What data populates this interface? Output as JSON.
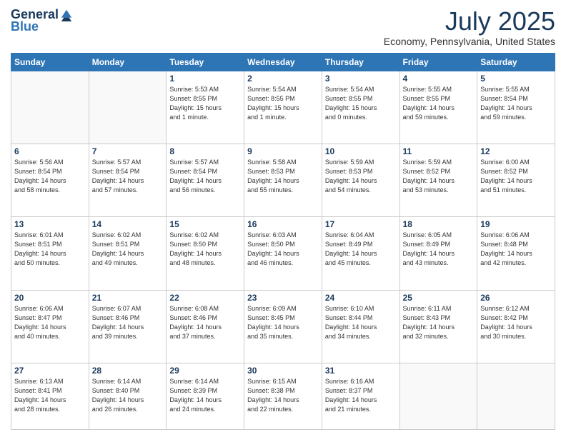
{
  "logo": {
    "general": "General",
    "blue": "Blue"
  },
  "title": "July 2025",
  "location": "Economy, Pennsylvania, United States",
  "days_of_week": [
    "Sunday",
    "Monday",
    "Tuesday",
    "Wednesday",
    "Thursday",
    "Friday",
    "Saturday"
  ],
  "weeks": [
    [
      {
        "day": "",
        "detail": ""
      },
      {
        "day": "",
        "detail": ""
      },
      {
        "day": "1",
        "detail": "Sunrise: 5:53 AM\nSunset: 8:55 PM\nDaylight: 15 hours\nand 1 minute."
      },
      {
        "day": "2",
        "detail": "Sunrise: 5:54 AM\nSunset: 8:55 PM\nDaylight: 15 hours\nand 1 minute."
      },
      {
        "day": "3",
        "detail": "Sunrise: 5:54 AM\nSunset: 8:55 PM\nDaylight: 15 hours\nand 0 minutes."
      },
      {
        "day": "4",
        "detail": "Sunrise: 5:55 AM\nSunset: 8:55 PM\nDaylight: 14 hours\nand 59 minutes."
      },
      {
        "day": "5",
        "detail": "Sunrise: 5:55 AM\nSunset: 8:54 PM\nDaylight: 14 hours\nand 59 minutes."
      }
    ],
    [
      {
        "day": "6",
        "detail": "Sunrise: 5:56 AM\nSunset: 8:54 PM\nDaylight: 14 hours\nand 58 minutes."
      },
      {
        "day": "7",
        "detail": "Sunrise: 5:57 AM\nSunset: 8:54 PM\nDaylight: 14 hours\nand 57 minutes."
      },
      {
        "day": "8",
        "detail": "Sunrise: 5:57 AM\nSunset: 8:54 PM\nDaylight: 14 hours\nand 56 minutes."
      },
      {
        "day": "9",
        "detail": "Sunrise: 5:58 AM\nSunset: 8:53 PM\nDaylight: 14 hours\nand 55 minutes."
      },
      {
        "day": "10",
        "detail": "Sunrise: 5:59 AM\nSunset: 8:53 PM\nDaylight: 14 hours\nand 54 minutes."
      },
      {
        "day": "11",
        "detail": "Sunrise: 5:59 AM\nSunset: 8:52 PM\nDaylight: 14 hours\nand 53 minutes."
      },
      {
        "day": "12",
        "detail": "Sunrise: 6:00 AM\nSunset: 8:52 PM\nDaylight: 14 hours\nand 51 minutes."
      }
    ],
    [
      {
        "day": "13",
        "detail": "Sunrise: 6:01 AM\nSunset: 8:51 PM\nDaylight: 14 hours\nand 50 minutes."
      },
      {
        "day": "14",
        "detail": "Sunrise: 6:02 AM\nSunset: 8:51 PM\nDaylight: 14 hours\nand 49 minutes."
      },
      {
        "day": "15",
        "detail": "Sunrise: 6:02 AM\nSunset: 8:50 PM\nDaylight: 14 hours\nand 48 minutes."
      },
      {
        "day": "16",
        "detail": "Sunrise: 6:03 AM\nSunset: 8:50 PM\nDaylight: 14 hours\nand 46 minutes."
      },
      {
        "day": "17",
        "detail": "Sunrise: 6:04 AM\nSunset: 8:49 PM\nDaylight: 14 hours\nand 45 minutes."
      },
      {
        "day": "18",
        "detail": "Sunrise: 6:05 AM\nSunset: 8:49 PM\nDaylight: 14 hours\nand 43 minutes."
      },
      {
        "day": "19",
        "detail": "Sunrise: 6:06 AM\nSunset: 8:48 PM\nDaylight: 14 hours\nand 42 minutes."
      }
    ],
    [
      {
        "day": "20",
        "detail": "Sunrise: 6:06 AM\nSunset: 8:47 PM\nDaylight: 14 hours\nand 40 minutes."
      },
      {
        "day": "21",
        "detail": "Sunrise: 6:07 AM\nSunset: 8:46 PM\nDaylight: 14 hours\nand 39 minutes."
      },
      {
        "day": "22",
        "detail": "Sunrise: 6:08 AM\nSunset: 8:46 PM\nDaylight: 14 hours\nand 37 minutes."
      },
      {
        "day": "23",
        "detail": "Sunrise: 6:09 AM\nSunset: 8:45 PM\nDaylight: 14 hours\nand 35 minutes."
      },
      {
        "day": "24",
        "detail": "Sunrise: 6:10 AM\nSunset: 8:44 PM\nDaylight: 14 hours\nand 34 minutes."
      },
      {
        "day": "25",
        "detail": "Sunrise: 6:11 AM\nSunset: 8:43 PM\nDaylight: 14 hours\nand 32 minutes."
      },
      {
        "day": "26",
        "detail": "Sunrise: 6:12 AM\nSunset: 8:42 PM\nDaylight: 14 hours\nand 30 minutes."
      }
    ],
    [
      {
        "day": "27",
        "detail": "Sunrise: 6:13 AM\nSunset: 8:41 PM\nDaylight: 14 hours\nand 28 minutes."
      },
      {
        "day": "28",
        "detail": "Sunrise: 6:14 AM\nSunset: 8:40 PM\nDaylight: 14 hours\nand 26 minutes."
      },
      {
        "day": "29",
        "detail": "Sunrise: 6:14 AM\nSunset: 8:39 PM\nDaylight: 14 hours\nand 24 minutes."
      },
      {
        "day": "30",
        "detail": "Sunrise: 6:15 AM\nSunset: 8:38 PM\nDaylight: 14 hours\nand 22 minutes."
      },
      {
        "day": "31",
        "detail": "Sunrise: 6:16 AM\nSunset: 8:37 PM\nDaylight: 14 hours\nand 21 minutes."
      },
      {
        "day": "",
        "detail": ""
      },
      {
        "day": "",
        "detail": ""
      }
    ]
  ]
}
